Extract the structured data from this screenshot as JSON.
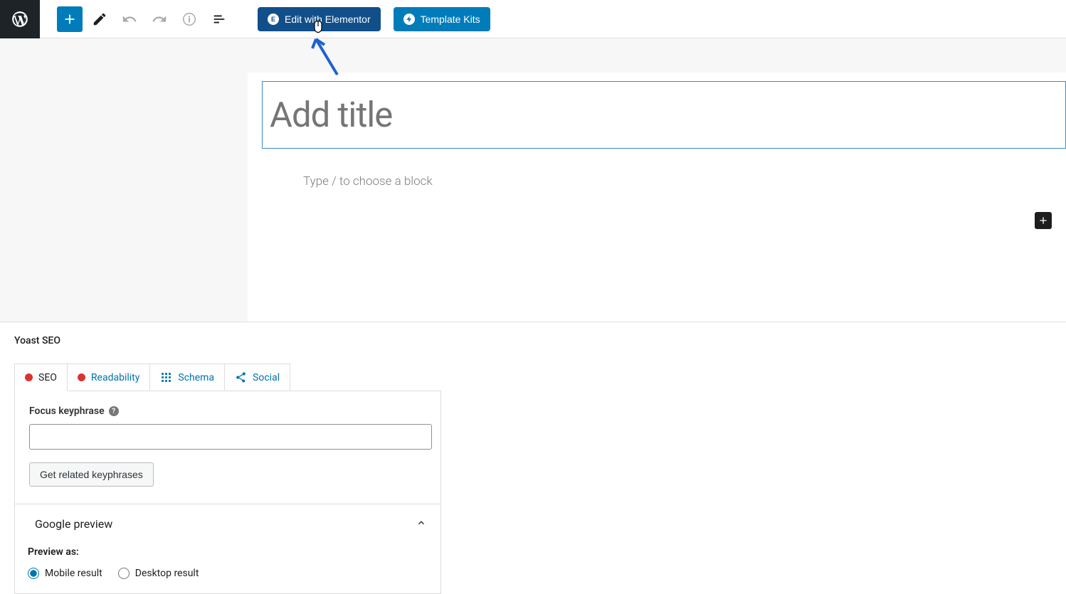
{
  "toolbar": {
    "edit_elementor_label": "Edit with Elementor",
    "template_kits_label": "Template Kits"
  },
  "editor": {
    "title_placeholder": "Add title",
    "block_hint": "Type / to choose a block"
  },
  "yoast": {
    "section_title": "Yoast SEO",
    "tabs": {
      "seo": "SEO",
      "readability": "Readability",
      "schema": "Schema",
      "social": "Social"
    },
    "focus_keyphrase_label": "Focus keyphrase",
    "related_keyphrases_label": "Get related keyphrases",
    "google_preview_title": "Google preview",
    "preview_as_label": "Preview as:",
    "mobile_result_label": "Mobile result",
    "desktop_result_label": "Desktop result"
  }
}
